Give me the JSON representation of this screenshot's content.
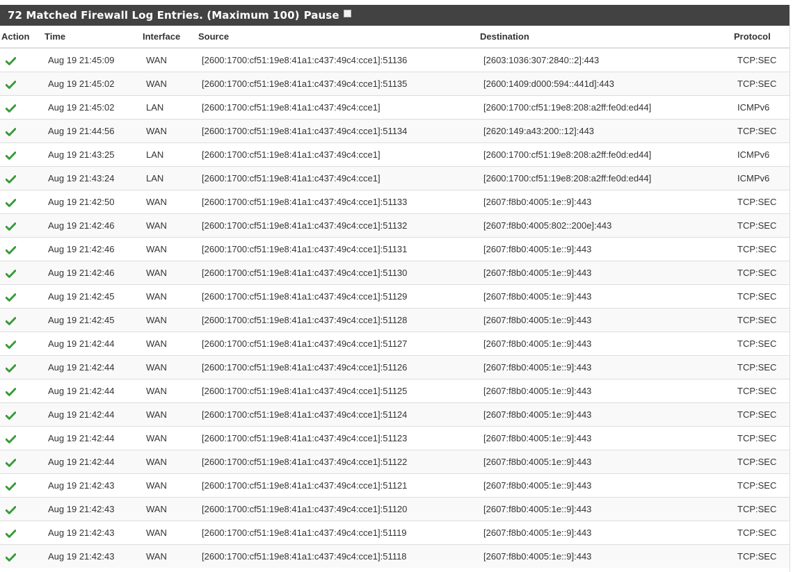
{
  "panel": {
    "title": "72 Matched Firewall Log Entries. (Maximum 100)",
    "pause_label": "Pause"
  },
  "columns": {
    "action": "Action",
    "time": "Time",
    "interface": "Interface",
    "source": "Source",
    "destination": "Destination",
    "protocol": "Protocol"
  },
  "colors": {
    "header_bg": "#424242",
    "pass_icon": "#3a9a3a",
    "stripe": "#f9f9f9"
  },
  "action_icon": "check-icon",
  "rows": [
    {
      "time": "Aug 19 21:45:09",
      "interface": "WAN",
      "source": "[2600:1700:cf51:19e8:41a1:c437:49c4:cce1]:51136",
      "destination": "[2603:1036:307:2840::2]:443",
      "protocol": "TCP:SEC"
    },
    {
      "time": "Aug 19 21:45:02",
      "interface": "WAN",
      "source": "[2600:1700:cf51:19e8:41a1:c437:49c4:cce1]:51135",
      "destination": "[2600:1409:d000:594::441d]:443",
      "protocol": "TCP:SEC"
    },
    {
      "time": "Aug 19 21:45:02",
      "interface": "LAN",
      "source": "[2600:1700:cf51:19e8:41a1:c437:49c4:cce1]",
      "destination": "[2600:1700:cf51:19e8:208:a2ff:fe0d:ed44]",
      "protocol": "ICMPv6"
    },
    {
      "time": "Aug 19 21:44:56",
      "interface": "WAN",
      "source": "[2600:1700:cf51:19e8:41a1:c437:49c4:cce1]:51134",
      "destination": "[2620:149:a43:200::12]:443",
      "protocol": "TCP:SEC"
    },
    {
      "time": "Aug 19 21:43:25",
      "interface": "LAN",
      "source": "[2600:1700:cf51:19e8:41a1:c437:49c4:cce1]",
      "destination": "[2600:1700:cf51:19e8:208:a2ff:fe0d:ed44]",
      "protocol": "ICMPv6"
    },
    {
      "time": "Aug 19 21:43:24",
      "interface": "LAN",
      "source": "[2600:1700:cf51:19e8:41a1:c437:49c4:cce1]",
      "destination": "[2600:1700:cf51:19e8:208:a2ff:fe0d:ed44]",
      "protocol": "ICMPv6"
    },
    {
      "time": "Aug 19 21:42:50",
      "interface": "WAN",
      "source": "[2600:1700:cf51:19e8:41a1:c437:49c4:cce1]:51133",
      "destination": "[2607:f8b0:4005:1e::9]:443",
      "protocol": "TCP:SEC"
    },
    {
      "time": "Aug 19 21:42:46",
      "interface": "WAN",
      "source": "[2600:1700:cf51:19e8:41a1:c437:49c4:cce1]:51132",
      "destination": "[2607:f8b0:4005:802::200e]:443",
      "protocol": "TCP:SEC"
    },
    {
      "time": "Aug 19 21:42:46",
      "interface": "WAN",
      "source": "[2600:1700:cf51:19e8:41a1:c437:49c4:cce1]:51131",
      "destination": "[2607:f8b0:4005:1e::9]:443",
      "protocol": "TCP:SEC"
    },
    {
      "time": "Aug 19 21:42:46",
      "interface": "WAN",
      "source": "[2600:1700:cf51:19e8:41a1:c437:49c4:cce1]:51130",
      "destination": "[2607:f8b0:4005:1e::9]:443",
      "protocol": "TCP:SEC"
    },
    {
      "time": "Aug 19 21:42:45",
      "interface": "WAN",
      "source": "[2600:1700:cf51:19e8:41a1:c437:49c4:cce1]:51129",
      "destination": "[2607:f8b0:4005:1e::9]:443",
      "protocol": "TCP:SEC"
    },
    {
      "time": "Aug 19 21:42:45",
      "interface": "WAN",
      "source": "[2600:1700:cf51:19e8:41a1:c437:49c4:cce1]:51128",
      "destination": "[2607:f8b0:4005:1e::9]:443",
      "protocol": "TCP:SEC"
    },
    {
      "time": "Aug 19 21:42:44",
      "interface": "WAN",
      "source": "[2600:1700:cf51:19e8:41a1:c437:49c4:cce1]:51127",
      "destination": "[2607:f8b0:4005:1e::9]:443",
      "protocol": "TCP:SEC"
    },
    {
      "time": "Aug 19 21:42:44",
      "interface": "WAN",
      "source": "[2600:1700:cf51:19e8:41a1:c437:49c4:cce1]:51126",
      "destination": "[2607:f8b0:4005:1e::9]:443",
      "protocol": "TCP:SEC"
    },
    {
      "time": "Aug 19 21:42:44",
      "interface": "WAN",
      "source": "[2600:1700:cf51:19e8:41a1:c437:49c4:cce1]:51125",
      "destination": "[2607:f8b0:4005:1e::9]:443",
      "protocol": "TCP:SEC"
    },
    {
      "time": "Aug 19 21:42:44",
      "interface": "WAN",
      "source": "[2600:1700:cf51:19e8:41a1:c437:49c4:cce1]:51124",
      "destination": "[2607:f8b0:4005:1e::9]:443",
      "protocol": "TCP:SEC"
    },
    {
      "time": "Aug 19 21:42:44",
      "interface": "WAN",
      "source": "[2600:1700:cf51:19e8:41a1:c437:49c4:cce1]:51123",
      "destination": "[2607:f8b0:4005:1e::9]:443",
      "protocol": "TCP:SEC"
    },
    {
      "time": "Aug 19 21:42:44",
      "interface": "WAN",
      "source": "[2600:1700:cf51:19e8:41a1:c437:49c4:cce1]:51122",
      "destination": "[2607:f8b0:4005:1e::9]:443",
      "protocol": "TCP:SEC"
    },
    {
      "time": "Aug 19 21:42:43",
      "interface": "WAN",
      "source": "[2600:1700:cf51:19e8:41a1:c437:49c4:cce1]:51121",
      "destination": "[2607:f8b0:4005:1e::9]:443",
      "protocol": "TCP:SEC"
    },
    {
      "time": "Aug 19 21:42:43",
      "interface": "WAN",
      "source": "[2600:1700:cf51:19e8:41a1:c437:49c4:cce1]:51120",
      "destination": "[2607:f8b0:4005:1e::9]:443",
      "protocol": "TCP:SEC"
    },
    {
      "time": "Aug 19 21:42:43",
      "interface": "WAN",
      "source": "[2600:1700:cf51:19e8:41a1:c437:49c4:cce1]:51119",
      "destination": "[2607:f8b0:4005:1e::9]:443",
      "protocol": "TCP:SEC"
    },
    {
      "time": "Aug 19 21:42:43",
      "interface": "WAN",
      "source": "[2600:1700:cf51:19e8:41a1:c437:49c4:cce1]:51118",
      "destination": "[2607:f8b0:4005:1e::9]:443",
      "protocol": "TCP:SEC"
    }
  ]
}
